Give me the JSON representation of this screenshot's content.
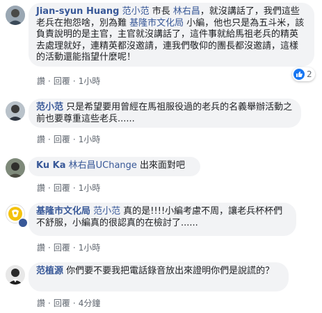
{
  "actions": {
    "like": "讚",
    "reply": "回覆",
    "dot": "·"
  },
  "comments": [
    {
      "author": "Jian-syun Huang",
      "segments": [
        {
          "t": "mention",
          "v": "范小范"
        },
        {
          "t": "text",
          "v": " 市長 "
        },
        {
          "t": "mention",
          "v": "林右昌"
        },
        {
          "t": "text",
          "v": "，就沒講話了，我們這些老兵在抱怨啥，別為難 "
        },
        {
          "t": "mention",
          "v": "基隆市文化局"
        },
        {
          "t": "text",
          "v": " 小編，他也只是為五斗米，該負責說明的是主官，主官就沒講話了，這件事就給馬祖老兵的精英去處理就好，連精英都沒邀請，連我們敬仰的團長都沒邀請，這樣的活動還能指望什麼呢！"
        }
      ],
      "time": "1小時",
      "reactions": {
        "icon": "like-icon",
        "count": "2"
      }
    },
    {
      "author": "范小范",
      "segments": [
        {
          "t": "text",
          "v": "只是希望要用曾經在馬祖服役過的老兵的名義舉辦活動之前也要尊重這些老兵......"
        }
      ],
      "time": "1小時"
    },
    {
      "author": "Ku Ka",
      "segments": [
        {
          "t": "mention",
          "v": "林右昌UChange"
        },
        {
          "t": "text",
          "v": " 出來面對吧"
        }
      ],
      "time": "1小時"
    },
    {
      "author": "基隆市文化局",
      "segments": [
        {
          "t": "mention",
          "v": "范小范"
        },
        {
          "t": "text",
          "v": " 真的是!!!!小編考慮不周，讓老兵杯杯們不舒服，小編真的很認真的在檢討了......"
        }
      ],
      "time": "1小時"
    },
    {
      "author": "范植源",
      "segments": [
        {
          "t": "text",
          "v": "你們要不要我把電話錄音放出來證明你們是說謊的？"
        }
      ],
      "time": "4分鐘"
    }
  ],
  "colors": {
    "link": "#385898",
    "bubble": "#f2f3f5",
    "meta": "#606770",
    "like": "#1877f2"
  }
}
